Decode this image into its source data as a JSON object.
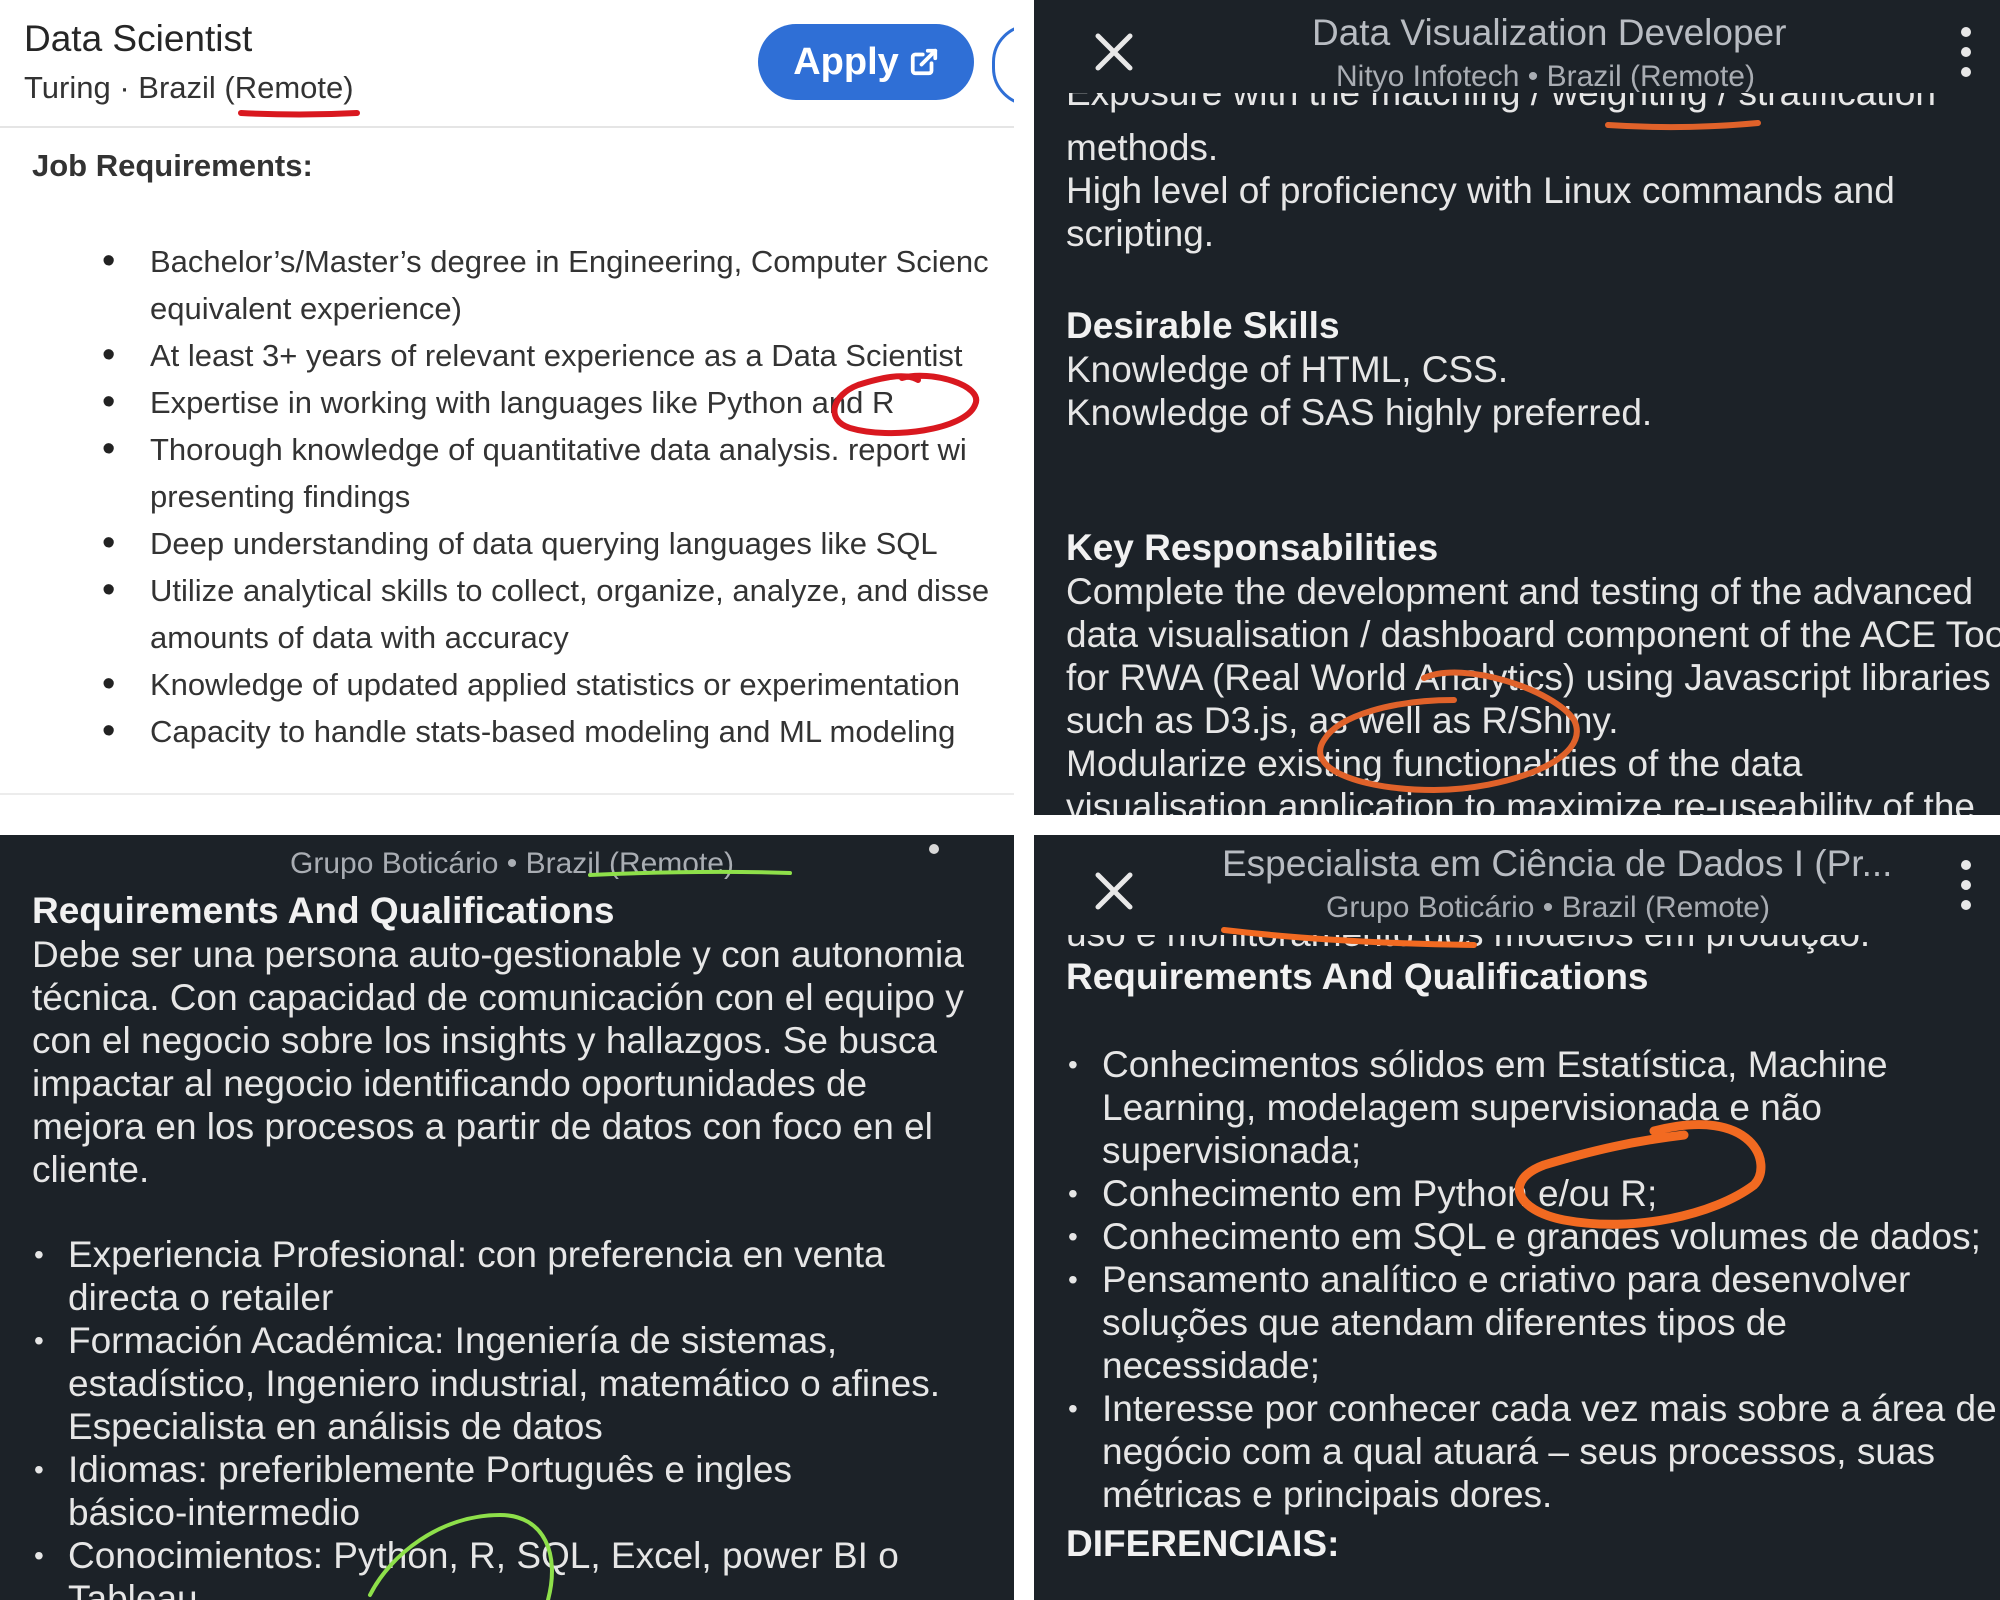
{
  "panel1": {
    "title": "Data Scientist",
    "subtitle": "Turing · Brazil (Remote)",
    "apply_label": "Apply",
    "heading": "Job Requirements:",
    "items": [
      [
        "Bachelor’s/Master’s degree in Engineering, Computer Scienc",
        "equivalent experience)"
      ],
      [
        "At least 3+ years of relevant experience as a Data Scientist"
      ],
      [
        "Expertise in working with languages like Python and R"
      ],
      [
        "Thorough knowledge of quantitative data analysis. report wi",
        "presenting findings"
      ],
      [
        "Deep understanding of data querying languages like SQL"
      ],
      [
        "Utilize analytical skills to collect, organize, analyze, and disse",
        "amounts of data with accuracy"
      ],
      [
        "Knowledge of updated applied statistics or experimentation"
      ],
      [
        "Capacity to handle stats-based modeling and ML modeling"
      ]
    ],
    "annotation_color": "#d9181f"
  },
  "panel2": {
    "title": "Data Visualization Developer",
    "subtitle": "Nityo Infotech • Brazil (Remote)",
    "lines_top": [
      "methods.",
      "High level of proficiency with Linux commands and",
      "scripting."
    ],
    "desirable_heading": "Desirable Skills",
    "desirable_lines": [
      "Knowledge of HTML, CSS.",
      "Knowledge of SAS highly preferred."
    ],
    "key_heading": "Key Responsabilities",
    "key_lines": [
      "Complete the development and testing of the advanced",
      "data visualisation / dashboard component of the ACE Too",
      "for RWA (Real World Analytics) using Javascript libraries",
      "such as D3.js, as well as R/Shiny.",
      "Modularize existing functionalities of the data",
      "visualisation application to maximize re-useability of the"
    ],
    "annotation_color": "#e0622a"
  },
  "panel3": {
    "subtitle": "Grupo Boticário • Brazil (Remote)",
    "heading": "Requirements And Qualifications",
    "para_lines": [
      "Debe ser una persona auto-gestionable y con autonomia",
      "técnica. Con capacidad de comunicación con el equipo y",
      "con el negocio sobre los insights y hallazgos. Se busca",
      "impactar al negocio identificando oportunidades de",
      "mejora en los procesos a partir de datos con foco en el",
      "cliente."
    ],
    "items": [
      [
        "Experiencia Profesional: con preferencia en venta",
        "directa o retailer"
      ],
      [
        "Formación Académica: Ingeniería de sistemas,",
        "estadístico, Ingeniero industrial, matemático o afines.",
        "Especialista en análisis de datos"
      ],
      [
        "Idiomas: preferiblemente Português e ingles",
        "básico-intermedio"
      ],
      [
        "Conocimientos: Python, R, SQL, Excel, power BI o",
        "Tableau"
      ]
    ],
    "annotation_color": "#8ee04a"
  },
  "panel4": {
    "title": "Especialista em Ciência de Dados I (Pr...",
    "subtitle": "Grupo Boticário • Brazil (Remote)",
    "heading": "Requirements And Qualifications",
    "items": [
      [
        "Conhecimentos sólidos em Estatística, Machine",
        "Learning, modelagem supervisionada e não",
        "supervisionada;"
      ],
      [
        "Conhecimento em Python e/ou R;"
      ],
      [
        "Conhecimento em SQL e grandes volumes de dados;"
      ],
      [
        "Pensamento analítico e criativo para desenvolver",
        "soluções que atendam diferentes tipos de",
        "necessidade;"
      ],
      [
        "Interesse por conhecer cada vez mais sobre a área de",
        "negócio com a qual atuará – seus processos, suas",
        "métricas e principais dores."
      ]
    ],
    "footer_heading": "DIFERENCIAIS:",
    "annotation_color": "#f26a21"
  }
}
